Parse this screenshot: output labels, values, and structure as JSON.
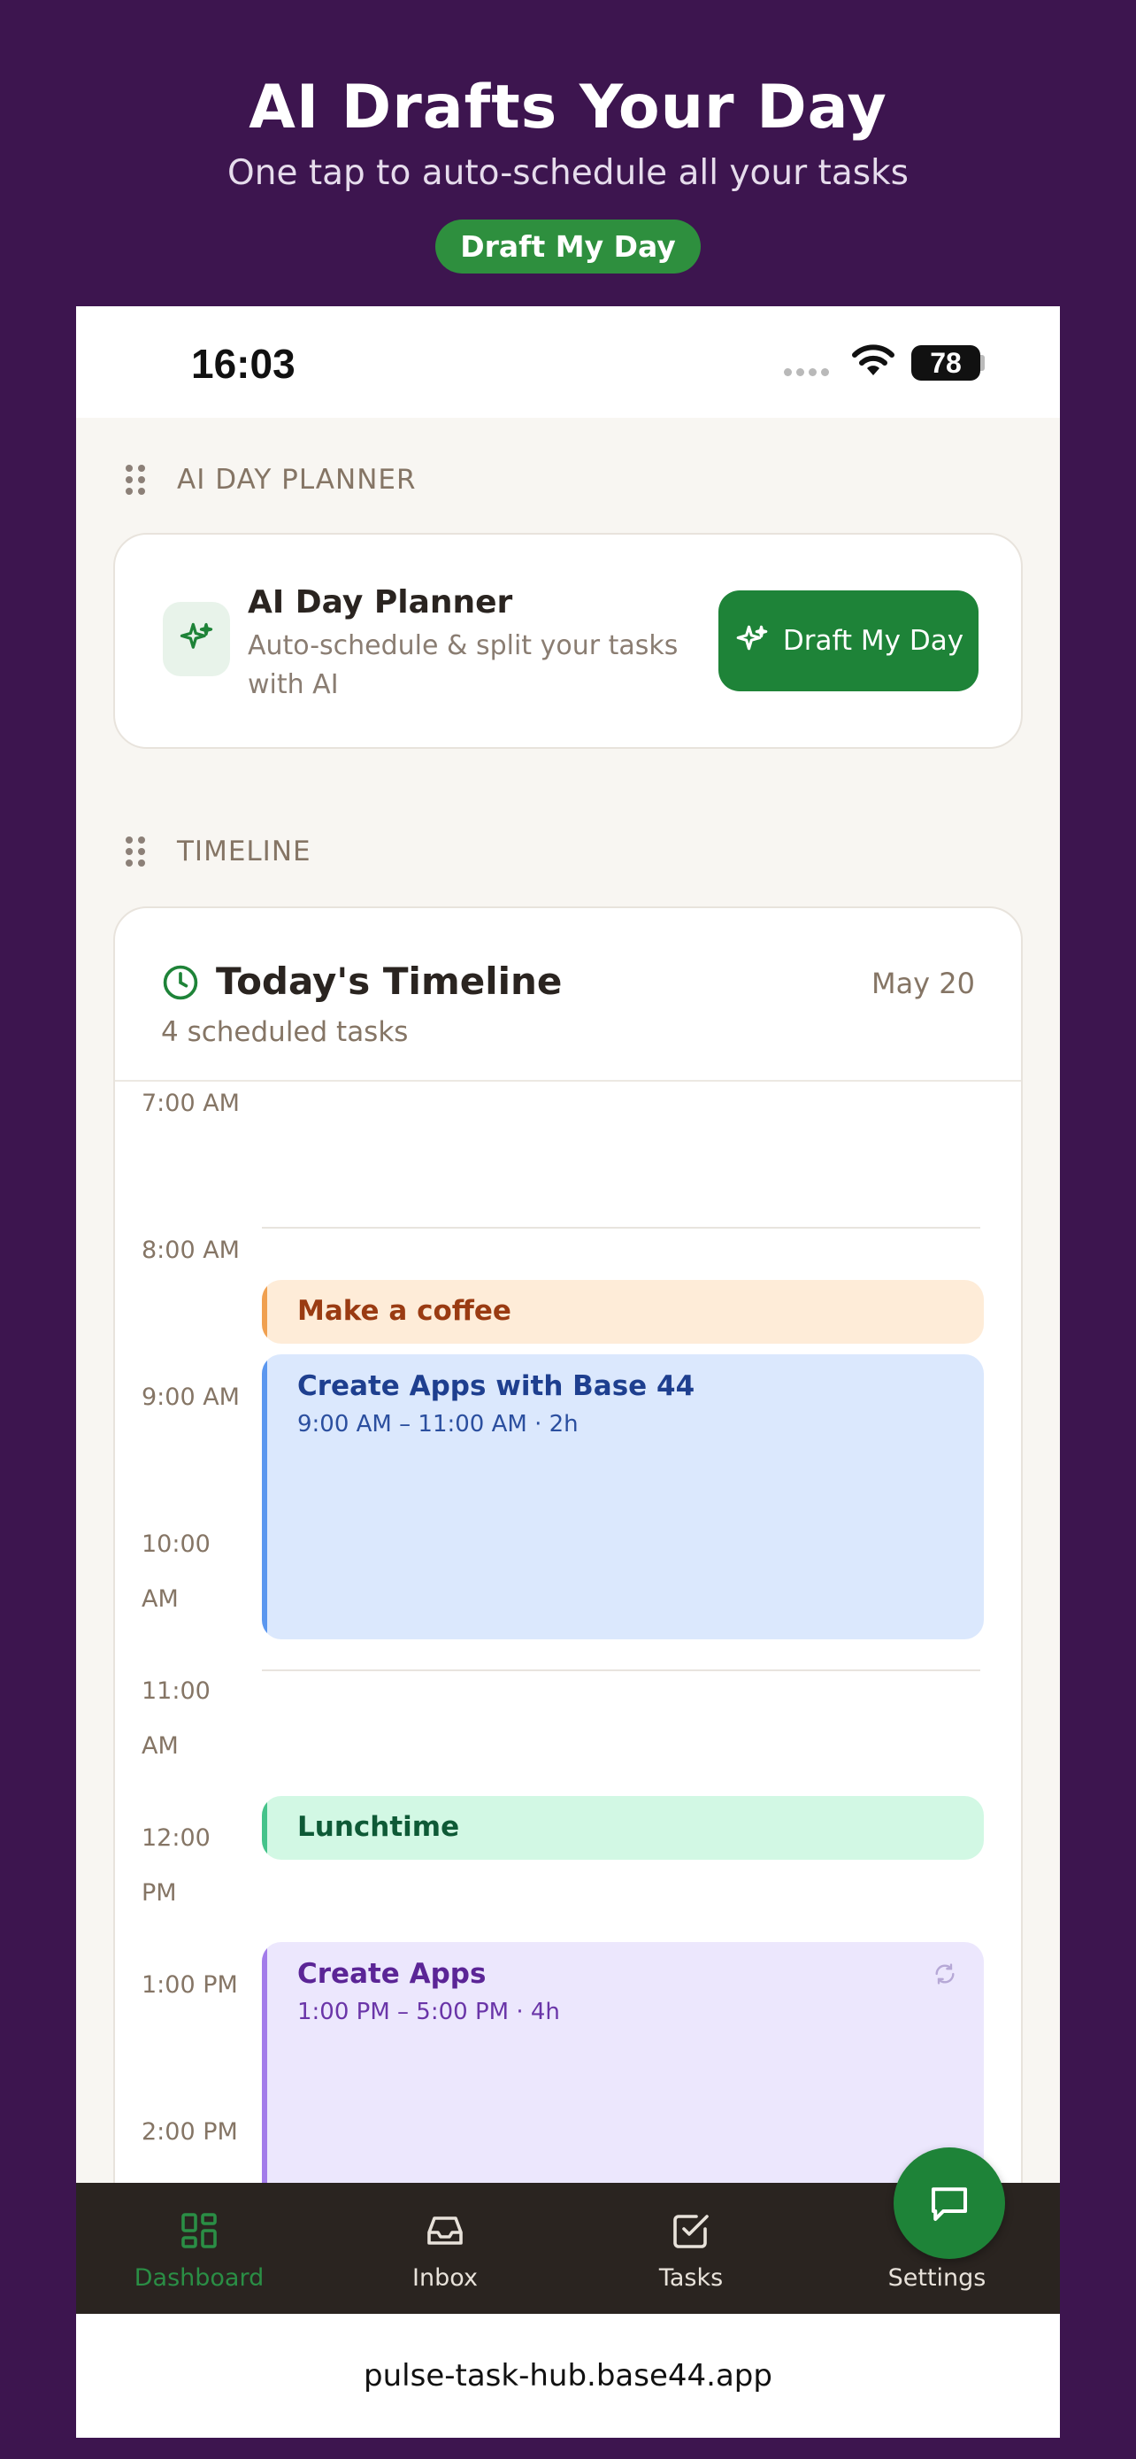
{
  "promo": {
    "title": "AI Drafts Your Day",
    "subtitle": "One tap to auto-schedule all your tasks",
    "pill": "Draft My Day"
  },
  "status": {
    "time": "16:03",
    "battery": "78"
  },
  "planner_section": {
    "header": "AI DAY PLANNER",
    "title": "AI Day Planner",
    "description": "Auto-schedule & split your tasks with AI",
    "button": "Draft My Day",
    "icon": "sparkles-icon"
  },
  "timeline_section": {
    "header": "TIMELINE",
    "title": "Today's Timeline",
    "date": "May 20",
    "count": "4 scheduled tasks",
    "hours": [
      "7:00 AM",
      "8:00 AM",
      "9:00 AM",
      "10:00 AM",
      "11:00 AM",
      "12:00 PM",
      "1:00 PM",
      "2:00 PM"
    ],
    "events": [
      {
        "title": "Make a coffee",
        "time": "",
        "color": "#9a3b12",
        "bg": "#feecd8",
        "accent": "#f0a050"
      },
      {
        "title": "Create Apps with Base 44",
        "time": "9:00 AM – 11:00 AM · 2h",
        "color": "#1e3f8f",
        "bg": "#dbe8fd",
        "accent": "#5b97ef"
      },
      {
        "title": "Lunchtime",
        "time": "",
        "color": "#0e5a36",
        "bg": "#d2f8e4",
        "accent": "#45c38a"
      },
      {
        "title": "Create Apps",
        "time": "1:00 PM – 5:00 PM · 4h",
        "color": "#5b2596",
        "bg": "#ece7fd",
        "accent": "#a37cea"
      }
    ]
  },
  "nav": {
    "items": [
      "Dashboard",
      "Inbox",
      "Tasks",
      "Settings"
    ],
    "active": "Dashboard"
  },
  "url": "pulse-task-hub.base44.app"
}
